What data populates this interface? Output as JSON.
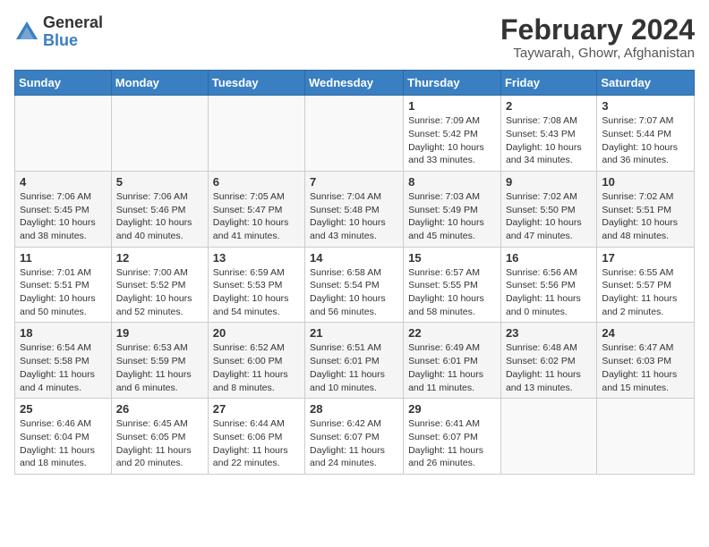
{
  "logo": {
    "general": "General",
    "blue": "Blue"
  },
  "header": {
    "title": "February 2024",
    "subtitle": "Taywarah, Ghowr, Afghanistan"
  },
  "weekdays": [
    "Sunday",
    "Monday",
    "Tuesday",
    "Wednesday",
    "Thursday",
    "Friday",
    "Saturday"
  ],
  "weeks": [
    [
      {
        "day": "",
        "info": ""
      },
      {
        "day": "",
        "info": ""
      },
      {
        "day": "",
        "info": ""
      },
      {
        "day": "",
        "info": ""
      },
      {
        "day": "1",
        "info": "Sunrise: 7:09 AM\nSunset: 5:42 PM\nDaylight: 10 hours\nand 33 minutes."
      },
      {
        "day": "2",
        "info": "Sunrise: 7:08 AM\nSunset: 5:43 PM\nDaylight: 10 hours\nand 34 minutes."
      },
      {
        "day": "3",
        "info": "Sunrise: 7:07 AM\nSunset: 5:44 PM\nDaylight: 10 hours\nand 36 minutes."
      }
    ],
    [
      {
        "day": "4",
        "info": "Sunrise: 7:06 AM\nSunset: 5:45 PM\nDaylight: 10 hours\nand 38 minutes."
      },
      {
        "day": "5",
        "info": "Sunrise: 7:06 AM\nSunset: 5:46 PM\nDaylight: 10 hours\nand 40 minutes."
      },
      {
        "day": "6",
        "info": "Sunrise: 7:05 AM\nSunset: 5:47 PM\nDaylight: 10 hours\nand 41 minutes."
      },
      {
        "day": "7",
        "info": "Sunrise: 7:04 AM\nSunset: 5:48 PM\nDaylight: 10 hours\nand 43 minutes."
      },
      {
        "day": "8",
        "info": "Sunrise: 7:03 AM\nSunset: 5:49 PM\nDaylight: 10 hours\nand 45 minutes."
      },
      {
        "day": "9",
        "info": "Sunrise: 7:02 AM\nSunset: 5:50 PM\nDaylight: 10 hours\nand 47 minutes."
      },
      {
        "day": "10",
        "info": "Sunrise: 7:02 AM\nSunset: 5:51 PM\nDaylight: 10 hours\nand 48 minutes."
      }
    ],
    [
      {
        "day": "11",
        "info": "Sunrise: 7:01 AM\nSunset: 5:51 PM\nDaylight: 10 hours\nand 50 minutes."
      },
      {
        "day": "12",
        "info": "Sunrise: 7:00 AM\nSunset: 5:52 PM\nDaylight: 10 hours\nand 52 minutes."
      },
      {
        "day": "13",
        "info": "Sunrise: 6:59 AM\nSunset: 5:53 PM\nDaylight: 10 hours\nand 54 minutes."
      },
      {
        "day": "14",
        "info": "Sunrise: 6:58 AM\nSunset: 5:54 PM\nDaylight: 10 hours\nand 56 minutes."
      },
      {
        "day": "15",
        "info": "Sunrise: 6:57 AM\nSunset: 5:55 PM\nDaylight: 10 hours\nand 58 minutes."
      },
      {
        "day": "16",
        "info": "Sunrise: 6:56 AM\nSunset: 5:56 PM\nDaylight: 11 hours\nand 0 minutes."
      },
      {
        "day": "17",
        "info": "Sunrise: 6:55 AM\nSunset: 5:57 PM\nDaylight: 11 hours\nand 2 minutes."
      }
    ],
    [
      {
        "day": "18",
        "info": "Sunrise: 6:54 AM\nSunset: 5:58 PM\nDaylight: 11 hours\nand 4 minutes."
      },
      {
        "day": "19",
        "info": "Sunrise: 6:53 AM\nSunset: 5:59 PM\nDaylight: 11 hours\nand 6 minutes."
      },
      {
        "day": "20",
        "info": "Sunrise: 6:52 AM\nSunset: 6:00 PM\nDaylight: 11 hours\nand 8 minutes."
      },
      {
        "day": "21",
        "info": "Sunrise: 6:51 AM\nSunset: 6:01 PM\nDaylight: 11 hours\nand 10 minutes."
      },
      {
        "day": "22",
        "info": "Sunrise: 6:49 AM\nSunset: 6:01 PM\nDaylight: 11 hours\nand 11 minutes."
      },
      {
        "day": "23",
        "info": "Sunrise: 6:48 AM\nSunset: 6:02 PM\nDaylight: 11 hours\nand 13 minutes."
      },
      {
        "day": "24",
        "info": "Sunrise: 6:47 AM\nSunset: 6:03 PM\nDaylight: 11 hours\nand 15 minutes."
      }
    ],
    [
      {
        "day": "25",
        "info": "Sunrise: 6:46 AM\nSunset: 6:04 PM\nDaylight: 11 hours\nand 18 minutes."
      },
      {
        "day": "26",
        "info": "Sunrise: 6:45 AM\nSunset: 6:05 PM\nDaylight: 11 hours\nand 20 minutes."
      },
      {
        "day": "27",
        "info": "Sunrise: 6:44 AM\nSunset: 6:06 PM\nDaylight: 11 hours\nand 22 minutes."
      },
      {
        "day": "28",
        "info": "Sunrise: 6:42 AM\nSunset: 6:07 PM\nDaylight: 11 hours\nand 24 minutes."
      },
      {
        "day": "29",
        "info": "Sunrise: 6:41 AM\nSunset: 6:07 PM\nDaylight: 11 hours\nand 26 minutes."
      },
      {
        "day": "",
        "info": ""
      },
      {
        "day": "",
        "info": ""
      }
    ]
  ]
}
